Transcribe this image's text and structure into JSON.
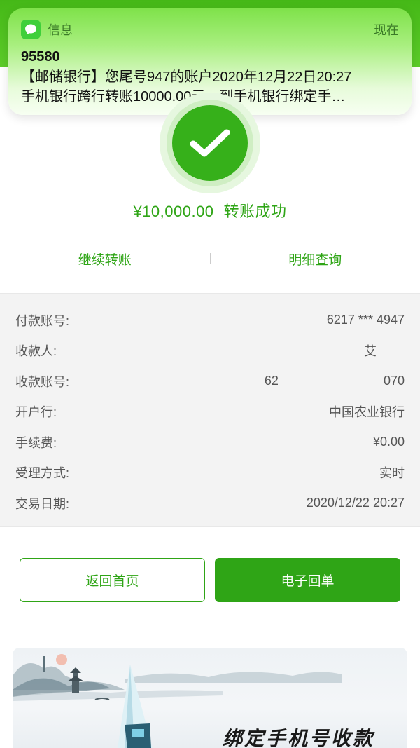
{
  "notification": {
    "app_name": "信息",
    "time": "现在",
    "sender": "95580",
    "body": "【邮储银行】您尾号947的账户2020年12月22日20:27\n手机银行跨行转账10000.00元。到手机银行绑定手…"
  },
  "result": {
    "amount": "¥10,000.00",
    "status": "转账成功"
  },
  "actions": {
    "continue_transfer": "继续转账",
    "detail_query": "明细查询"
  },
  "details": [
    {
      "label": "付款账号:",
      "value": "6217 *** 4947"
    },
    {
      "label": "收款人:",
      "value": "艾"
    },
    {
      "label": "收款账号:",
      "value": "62                              070"
    },
    {
      "label": "开户行:",
      "value": "中国农业银行"
    },
    {
      "label": "手续费:",
      "value": "¥0.00"
    },
    {
      "label": "受理方式:",
      "value": "实时"
    },
    {
      "label": "交易日期:",
      "value": "2020/12/22 20:27"
    }
  ],
  "buttons": {
    "back_home": "返回首页",
    "e_receipt": "电子回单"
  },
  "banner": {
    "title": "绑定手机号收款"
  },
  "colors": {
    "brand_green": "#2fa516",
    "header_green": "#45b817",
    "detail_bg": "#f3f3f3"
  }
}
